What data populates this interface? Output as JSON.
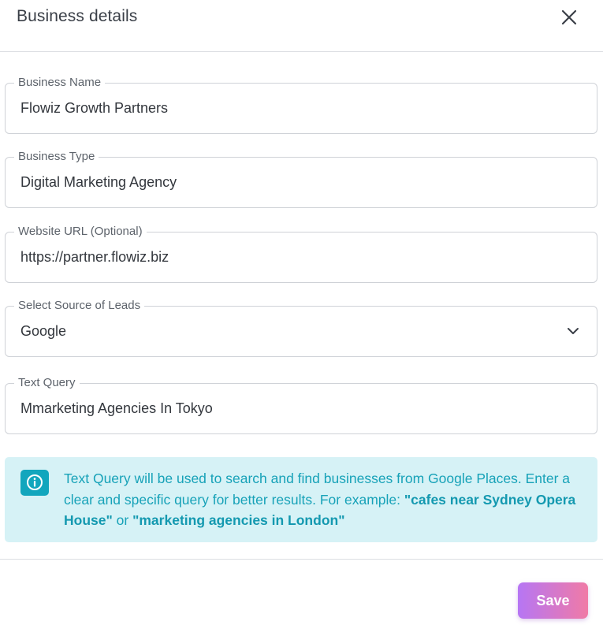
{
  "dialog": {
    "title": "Business details"
  },
  "fields": {
    "business_name": {
      "label": "Business Name",
      "value": "Flowiz Growth Partners"
    },
    "business_type": {
      "label": "Business Type",
      "value": "Digital Marketing Agency"
    },
    "website_url": {
      "label": "Website URL (Optional)",
      "value": "https://partner.flowiz.biz"
    },
    "lead_source": {
      "label": "Select Source of Leads",
      "value": "Google"
    },
    "text_query": {
      "label": "Text Query",
      "value": "Mmarketing Agencies In Tokyo"
    }
  },
  "info": {
    "text_part1": "Text Query will be used to search and find businesses from Google Places. Enter a clear and specific query for better results. For example: ",
    "example1": "\"cafes near Sydney Opera House\"",
    "text_or": " or ",
    "example2": "\"marketing agencies in London\""
  },
  "footer": {
    "save_label": "Save"
  },
  "icons": {
    "close": "close-icon",
    "dropdown": "chevron-down-icon",
    "info": "info-icon"
  },
  "colors": {
    "info_background": "#d6f2f6",
    "info_text": "#17a2b8",
    "save_gradient_start": "#b676f4",
    "save_gradient_end": "#f07aa6"
  }
}
